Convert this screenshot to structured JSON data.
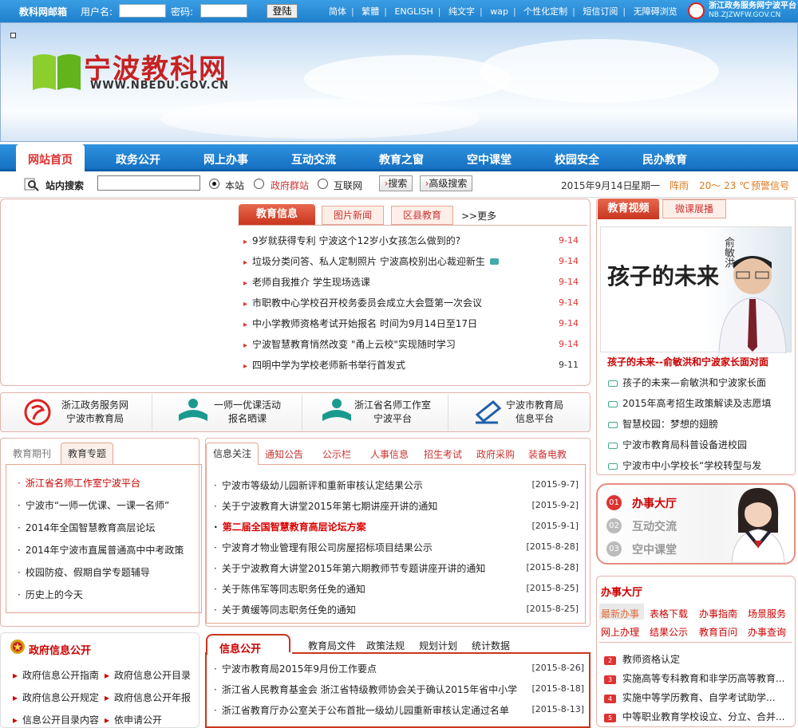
{
  "topbar": {
    "mail": "教科网邮箱",
    "user_label": "用户名:",
    "pass_label": "密码:",
    "login": "登陆",
    "links": [
      "简体",
      "繁體",
      "ENGLISH",
      "纯文字",
      "wap",
      "个性化定制",
      "短信订阅",
      "无障碍浏览"
    ],
    "zj_name": "浙江政务服务网宁波平台",
    "zj_url": "NB.ZJZWFW.GOV.CN"
  },
  "banner": {
    "title": "宁波教科网",
    "url": "WWW.NBEDU.GOV.CN"
  },
  "nav": [
    "网站首页",
    "政务公开",
    "网上办事",
    "互动交流",
    "教育之窗",
    "空中课堂",
    "校园安全",
    "民办教育"
  ],
  "search": {
    "label": "站内搜索",
    "options": [
      "本站",
      "政府群站",
      "互联网"
    ],
    "btn": "搜索",
    "adv": "高级搜索",
    "date": "2015年9月14日",
    "weekday": "星期一",
    "weather": "阵雨",
    "temp": "20～ 23 ℃",
    "warning": "预警信号"
  },
  "news": {
    "tabs": [
      "教育信息",
      "图片新闻",
      "区县教育"
    ],
    "more": ">>更多",
    "items": [
      {
        "title": "9岁就获得专利 宁波这个12岁小女孩怎么做到的?",
        "date": "9-14"
      },
      {
        "title": "垃圾分类问答、私人定制照片 宁波高校别出心裁迎新生",
        "date": "9-14"
      },
      {
        "title": "老师自我推介  学生现场选课",
        "date": "9-14"
      },
      {
        "title": "市职教中心学校召开校务委员会成立大会暨第一次会议",
        "date": "9-14"
      },
      {
        "title": "中小学教师资格考试开始报名 时间为9月14日至17日",
        "date": "9-14"
      },
      {
        "title": "宁波智慧教育悄然改变 \"甬上云校\"实现随时学习",
        "date": "9-14"
      },
      {
        "title": "四明中学为学校老师新书举行首发式",
        "date": "9-11"
      }
    ]
  },
  "video": {
    "tabs": [
      "教育视频",
      "微课展播"
    ],
    "poster_text": "孩子的未来",
    "poster_name": "俞敏洪",
    "caption": "孩子的未来--俞敏洪和宁波家长面对面",
    "items": [
      "孩子的未来—俞敏洪和宁波家长面",
      "2015年高考招生政策解读及志愿填",
      "智慧校园：梦想的翅膀",
      "宁波市教育局科普设备进校园",
      "宁波市中小学校长“学校转型与发"
    ]
  },
  "links4": [
    {
      "a": "浙江政务服务网",
      "b": "宁波市教育局"
    },
    {
      "a": "一师一优课活动",
      "b": "报名晒课"
    },
    {
      "a": "浙江省名师工作室",
      "b": "宁波平台"
    },
    {
      "a": "宁波市教育局",
      "b": "信息平台"
    }
  ],
  "special": {
    "tabs": [
      "教育期刊",
      "教育专题"
    ],
    "items": [
      "浙江省名师工作室宁波平台",
      "宁波市“一师一优课、一课一名师”",
      "2014年全国智慧教育高层论坛",
      "2014年宁波市直属普通高中中考政策",
      "校园防疫、假期自学专题辅导",
      "历史上的今天"
    ]
  },
  "info": {
    "tabs": [
      "信息关注",
      "通知公告",
      "公示栏",
      "人事信息",
      "招生考试",
      "政府采购",
      "装备电教"
    ],
    "items": [
      {
        "title": "宁波市等级幼儿园新评和重新审核认定结果公示",
        "date": "[2015-9-7]"
      },
      {
        "title": "关于宁波教育大讲堂2015年第七期讲座开讲的通知",
        "date": "[2015-9-2]"
      },
      {
        "title": "第二届全国智慧教育高层论坛方案",
        "date": "[2015-9-1]"
      },
      {
        "title": "宁波育才物业管理有限公司房屋招标项目结果公示",
        "date": "[2015-8-28]"
      },
      {
        "title": "关于宁波教育大讲堂2015年第六期教师节专题讲座开讲的通知",
        "date": "[2015-8-28]"
      },
      {
        "title": "关于陈伟军等同志职务任免的通知",
        "date": "[2015-8-25]"
      },
      {
        "title": "关于黄缓等同志职务任免的通知",
        "date": "[2015-8-25]"
      }
    ]
  },
  "service": {
    "items": [
      {
        "n": "01",
        "t": "办事大厅"
      },
      {
        "n": "02",
        "t": "互动交流"
      },
      {
        "n": "03",
        "t": "空中课堂"
      }
    ]
  },
  "hall": {
    "title": "办事大厅",
    "row1": [
      "最新办事",
      "表格下载",
      "办事指南",
      "场景服务"
    ],
    "row2": [
      "网上办理",
      "结果公示",
      "教育百问",
      "办事查询"
    ],
    "items": [
      {
        "n": "2",
        "t": "教师资格认定"
      },
      {
        "n": "3",
        "t": "实施高等专科教育和非学历高等教育..."
      },
      {
        "n": "4",
        "t": "实施中等学历教育、自学考试助学..."
      },
      {
        "n": "5",
        "t": "中等职业教育学校设立、分立、合并..."
      }
    ]
  },
  "govinfo": {
    "title": "政府信息公开",
    "items": [
      "政府信息公开指南",
      "政府信息公开目录",
      "政府信息公开规定",
      "政府信息公开年报",
      "信息公开目录内容",
      "依申请公开"
    ]
  },
  "publicinfo": {
    "tabs": [
      "信息公开",
      "教育局文件",
      "政策法规",
      "规划计划",
      "统计数据"
    ],
    "items": [
      {
        "title": "宁波市教育局2015年9月份工作要点",
        "date": "[2015-8-26]"
      },
      {
        "title": "浙江省人民教育基金会 浙江省特级教师协会关于确认2015年省中小学",
        "date": "[2015-8-18]"
      },
      {
        "title": "浙江省教育厅办公室关于公布首批一级幼儿园重新审核认定通过名单",
        "date": "[2015-8-13]"
      }
    ]
  },
  "colors": {
    "brand_blue": "#1f7fcc",
    "accent_red": "#d33"
  }
}
